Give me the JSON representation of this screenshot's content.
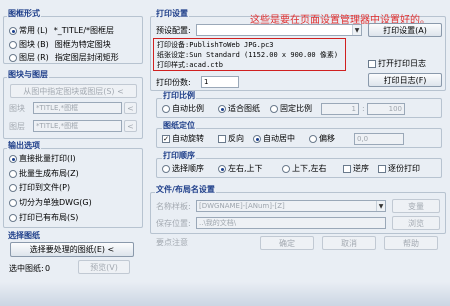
{
  "left_panel": {
    "layout_group": {
      "title": "图框形式",
      "common": "常用",
      "common_key": "(L)",
      "common_value": "*_TITLE/*图框层",
      "block": "图块",
      "block_key": "(B)",
      "block_value": "图框为特定图块",
      "layer": "图层",
      "layer_key": "(R)",
      "layer_value": "指定图层封闭矩形"
    },
    "block_layer_group": {
      "title": "图块与图层",
      "pick_button": "从图中指定图块或图层(S) <",
      "block_label": "图块",
      "block_value": "*TITLE,*图框",
      "layer_label": "图层",
      "layer_value": "*TITLE,*图框"
    },
    "output_group": {
      "title": "输出选项",
      "direct": "直接批量打印(I)",
      "batch_layout": "批量生成布局(Z)",
      "to_file": "打印到文件(P)",
      "split_dwg": "切分为单独DWG(G)",
      "existing_layout": "打印已有布局(S)"
    },
    "select_group": {
      "title": "选择图纸",
      "select_button": "选择要处理的图纸(E) <",
      "selected_label": "选中图纸:",
      "selected_count": "0",
      "preview_button": "预览(V)"
    }
  },
  "right_panel": {
    "print_settings": {
      "title": "打印设置",
      "preset_label": "预设配置:",
      "print_settings_button": "打印设置(A)",
      "annotation": "这些是要在页面设置管理器中设置好的。",
      "device_line": "打印设备:PublishToWeb JPG.pc3",
      "paper_line": "纸张设定:Sun Standard (1152.00 x 900.00 像素)",
      "style_line": "打印样式:acad.ctb",
      "open_log_check": "打开打印日志",
      "log_button": "打印日志(F)",
      "copies_label": "打印份数:",
      "copies_value": "1"
    },
    "scale_group": {
      "title": "打印比例",
      "auto": "自动比例",
      "fit": "适合图纸",
      "fixed": "固定比例",
      "ratio_left": "1",
      "ratio_right": "100"
    },
    "position_group": {
      "title": "图纸定位",
      "auto_rotate": "自动旋转",
      "reverse": "反向",
      "auto_center": "自动居中",
      "offset": "偏移",
      "offset_value": "0,0"
    },
    "order_group": {
      "title": "打印顺序",
      "select_order": "选择顺序",
      "lr_tb": "左右,上下",
      "tb_lr": "上下,左右",
      "reverse_order": "逆序",
      "paper_order": "逐份打印"
    },
    "file_group": {
      "title": "文件/布局名设置",
      "name_label": "名称样板:",
      "name_value": "[DWGNAME]-[ANum]-[Z]",
      "name_button": "变量",
      "save_label": "保存位置:",
      "save_value": "..\\我的文档\\",
      "save_button": "浏览"
    },
    "footer": {
      "footer_label": "要点注意",
      "ok": "确定",
      "cancel": "取消",
      "help": "帮助"
    }
  },
  "colors": {
    "accent": "#1f3f8a",
    "highlight_box": "#d02020",
    "annotation": "#e03030"
  }
}
